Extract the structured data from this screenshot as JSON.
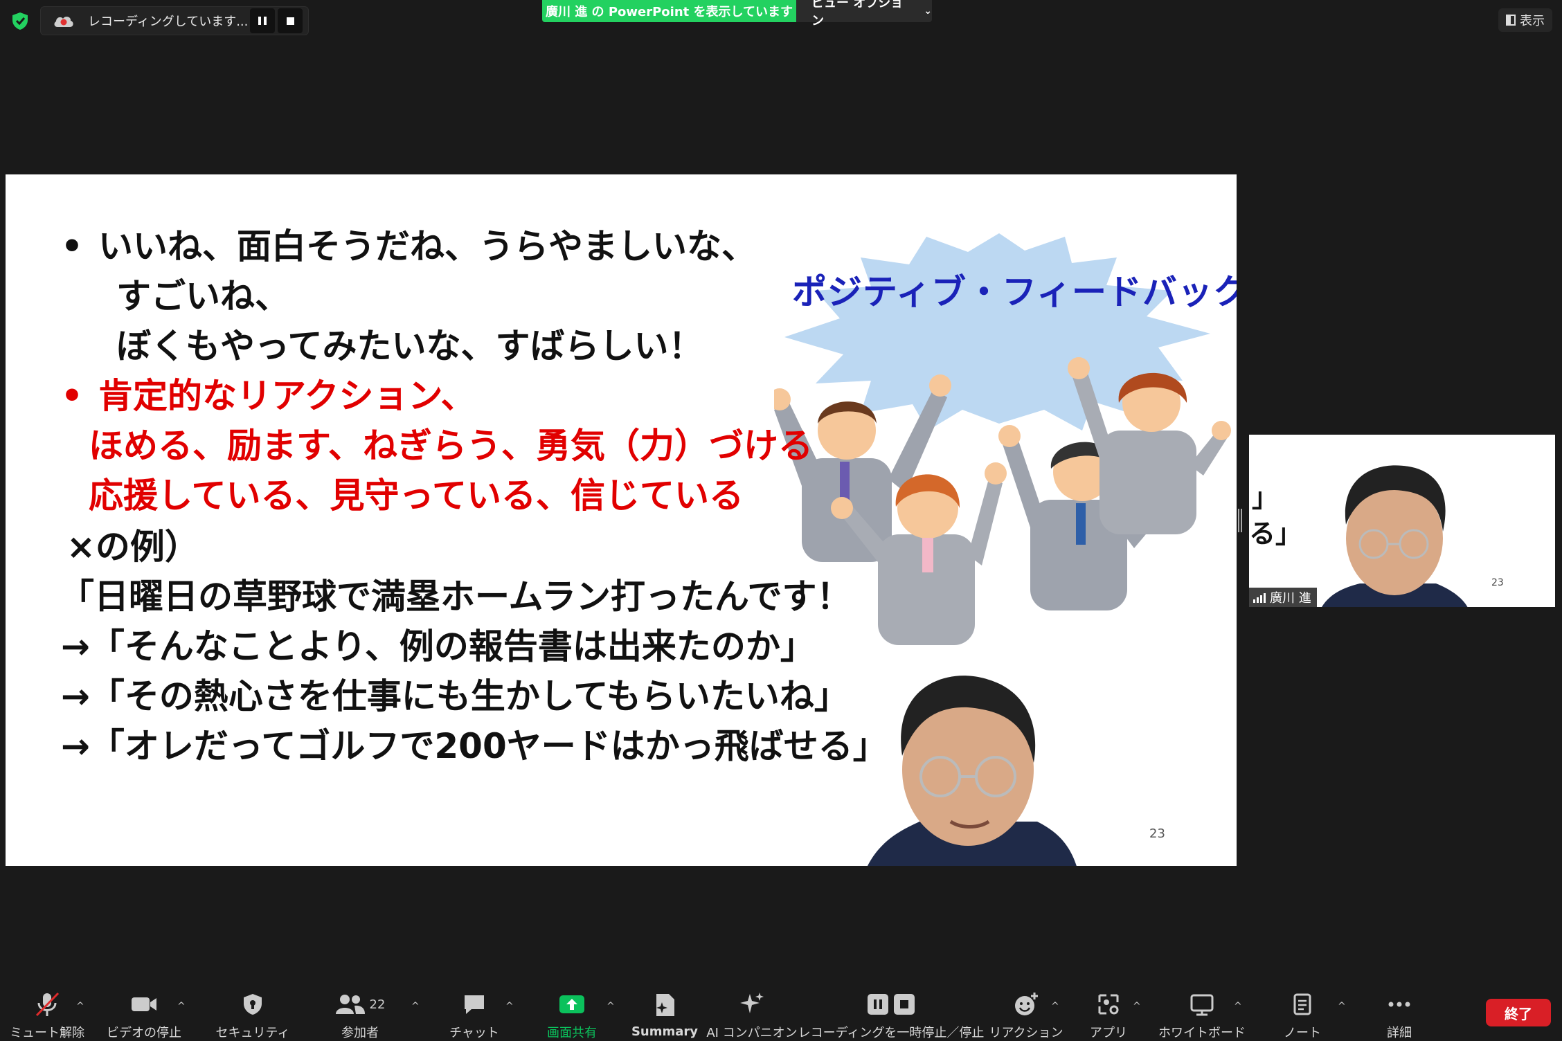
{
  "top_bar": {
    "recording_text": "レコーディングしています...",
    "share_banner": "廣川 進 の PowerPoint を表示しています",
    "view_options": "ビュー オプション",
    "display_button": "表示"
  },
  "slide": {
    "lines": [
      {
        "text": "いいね、面白そうだね、うらやましいな、",
        "color": "black"
      },
      {
        "text": "すごいね、",
        "color": "black"
      },
      {
        "text": "ぼくもやってみたいな、すばらしい！",
        "color": "black"
      },
      {
        "text": "肯定的なリアクション、",
        "color": "red"
      },
      {
        "text": "ほめる、励ます、ねぎらう、勇気（力）づける",
        "color": "red"
      },
      {
        "text": "応援している、見守っている、信じている",
        "color": "red"
      },
      {
        "text": "×の例）",
        "color": "black"
      },
      {
        "text": "「日曜日の草野球で満塁ホームラン打ったんです！",
        "color": "black"
      },
      {
        "text": "→「そんなことより、例の報告書は出来たのか」",
        "color": "black"
      },
      {
        "text": "→「その熱心さを仕事にも生かしてもらいたいね」",
        "color": "black"
      },
      {
        "text": "→「オレだってゴルフで200ヤードはかっ飛ばせる」",
        "color": "black"
      }
    ],
    "bullet": "•",
    "burst_title": "ポジティブ・フィードバック",
    "slide_number": "23"
  },
  "thumbnail": {
    "text_line1": "」",
    "text_line2": "る」",
    "slide_number": "23",
    "participant_name": "廣川 進"
  },
  "toolbar": {
    "items": [
      {
        "label": "ミュート解除"
      },
      {
        "label": "ビデオの停止"
      },
      {
        "label": "セキュリティ"
      },
      {
        "label": "参加者",
        "count": "22"
      },
      {
        "label": "チャット"
      },
      {
        "label": "画面共有"
      },
      {
        "label": "Summary"
      },
      {
        "label": "AI コンパニオン"
      },
      {
        "label": "レコーディングを一時停止／停止"
      },
      {
        "label": "リアクション"
      },
      {
        "label": "アプリ"
      },
      {
        "label": "ホワイトボード"
      },
      {
        "label": "ノート"
      },
      {
        "label": "詳細"
      }
    ],
    "end_button": "終了"
  },
  "colors": {
    "background": "#1a1a1a",
    "share_green": "#23d160",
    "share_screen_green": "#0bc15c",
    "end_red": "#d91f26",
    "slide_red": "#e10000",
    "burst_blue": "#1a22b8"
  }
}
